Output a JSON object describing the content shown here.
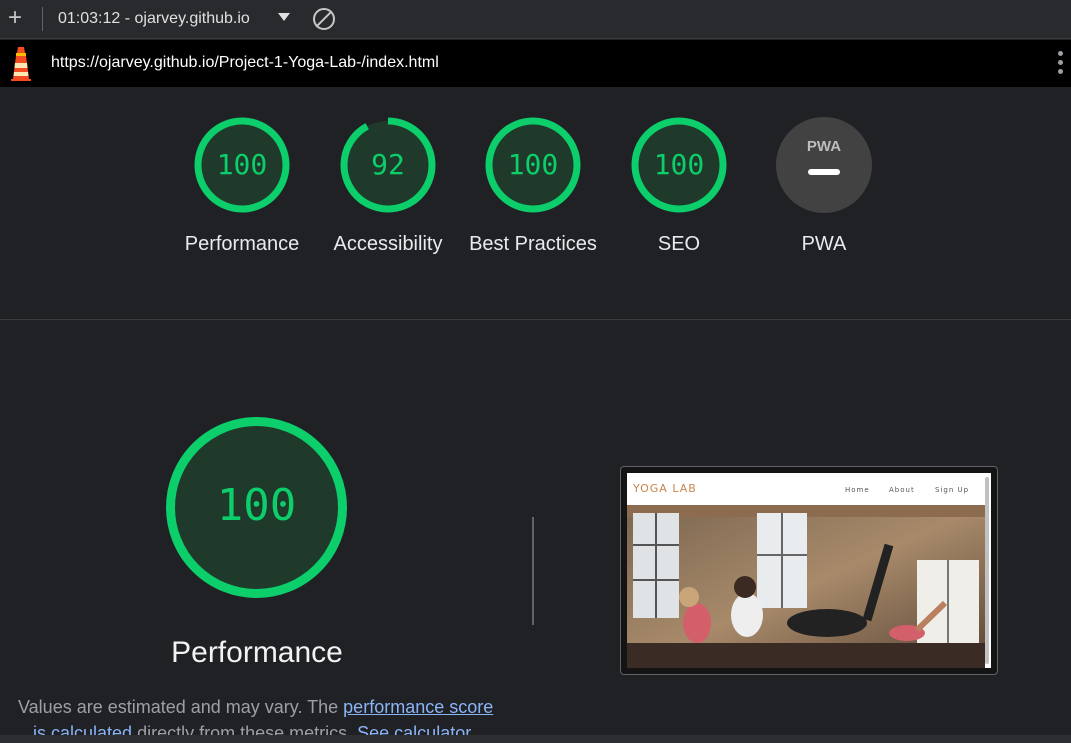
{
  "toolbar": {
    "session": "01:03:12 - ojarvey.github.io"
  },
  "urlbar": {
    "url": "https://ojarvey.github.io/Project-1-Yoga-Lab-/index.html"
  },
  "gauges": [
    {
      "score": "100",
      "label": "Performance",
      "value": 100
    },
    {
      "score": "92",
      "label": "Accessibility",
      "value": 92
    },
    {
      "score": "100",
      "label": "Best Practices",
      "value": 100
    },
    {
      "score": "100",
      "label": "SEO",
      "value": 100
    },
    {
      "score": "PWA",
      "label": "PWA",
      "value": null
    }
  ],
  "colors": {
    "pass": "#0cce6b",
    "pass_bg": "#1f3a2a",
    "pwa_bg": "#424242"
  },
  "performance": {
    "score": "100",
    "title": "Performance",
    "note_prefix": "Values are estimated and may vary. The ",
    "note_link1": "performance score",
    "note_link2": "is calculated",
    "note_middle": " directly from these metrics. ",
    "note_link3": "See calculator."
  },
  "screenshot": {
    "site_logo": "YOGA LAB",
    "nav_home": "Home",
    "nav_about": "About",
    "nav_signup": "Sign Up"
  }
}
